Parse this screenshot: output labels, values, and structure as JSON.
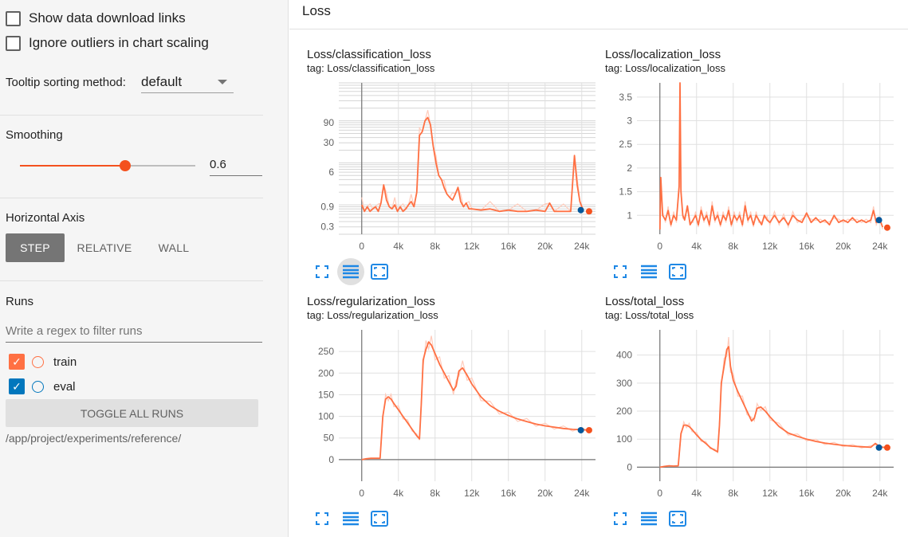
{
  "sidebar": {
    "show_download_links": "Show data download links",
    "ignore_outliers": "Ignore outliers in chart scaling",
    "tooltip_label": "Tooltip sorting method:",
    "tooltip_value": "default",
    "smoothing_label": "Smoothing",
    "smoothing_value": "0.6",
    "smoothing_fraction": 0.6,
    "horizontal_axis_label": "Horizontal Axis",
    "axis_buttons": {
      "step": "STEP",
      "relative": "RELATIVE",
      "wall": "WALL"
    },
    "runs_label": "Runs",
    "runs_filter_placeholder": "Write a regex to filter runs",
    "runs": [
      {
        "name": "train",
        "color": "#ff7043"
      },
      {
        "name": "eval",
        "color": "#0277bd"
      }
    ],
    "toggle_all": "TOGGLE ALL RUNS",
    "log_path": "/app/project/experiments/reference/"
  },
  "main": {
    "section_title": "Loss"
  },
  "colors": {
    "accent": "#f4511e",
    "train_line": "#ff7043",
    "train_raw": "#ffccbc",
    "eval_point": "#01579b",
    "toolbar_icon": "#1e88e5"
  },
  "icons": [
    "fullscreen-icon",
    "log-scale-icon",
    "fit-domain-icon"
  ],
  "chart_data": [
    {
      "type": "line",
      "title": "Loss/classification_loss",
      "tag": "tag: Loss/classification_loss",
      "yscale": "log",
      "yticks": [
        "90",
        "30",
        "6",
        "0.9",
        "0.3"
      ],
      "ytick_values": [
        90,
        30,
        6,
        0.9,
        0.3
      ],
      "xticks": [
        "0",
        "4k",
        "8k",
        "12k",
        "16k",
        "20k",
        "24k"
      ],
      "ylim": [
        0.2,
        800
      ],
      "xlim": [
        -2500,
        25500
      ],
      "series": [
        {
          "x": [
            0,
            300,
            600,
            900,
            1200,
            1500,
            1800,
            2100,
            2400,
            2700,
            3000,
            3300,
            3600,
            3900,
            4200,
            4500,
            4800,
            5100,
            5400,
            5700,
            6000,
            6300,
            6600,
            6900,
            7200,
            7500,
            7800,
            8100,
            8400,
            8700,
            9000,
            9300,
            9600,
            9900,
            10200,
            10500,
            10800,
            11100,
            11400,
            11700,
            12000,
            13000,
            14000,
            15000,
            16000,
            17000,
            18000,
            19000,
            20000,
            20500,
            21000,
            22000,
            22800,
            23200,
            23500,
            23800,
            24100
          ],
          "y": [
            1.0,
            0.7,
            0.9,
            0.7,
            0.8,
            0.9,
            0.7,
            1.1,
            3.0,
            1.3,
            0.9,
            0.8,
            1.0,
            0.7,
            0.9,
            0.7,
            0.8,
            1.0,
            1.2,
            0.9,
            2.0,
            45,
            55,
            100,
            120,
            80,
            25,
            10,
            5,
            4,
            2.5,
            1.8,
            1.5,
            1.3,
            1.8,
            2.6,
            1.2,
            0.9,
            1.1,
            0.8,
            0.8,
            0.75,
            0.8,
            0.7,
            0.75,
            0.7,
            0.7,
            0.75,
            0.7,
            1.1,
            0.7,
            0.7,
            0.7,
            15,
            3.0,
            1.2,
            0.8
          ]
        }
      ],
      "eval_points": [
        {
          "x": 23900,
          "y": 0.75
        }
      ],
      "last_point": {
        "x": 24800,
        "y": 0.7
      }
    },
    {
      "type": "line",
      "title": "Loss/localization_loss",
      "tag": "tag: Loss/localization_loss",
      "yscale": "linear",
      "yticks": [
        "1",
        "1.5",
        "2",
        "2.5",
        "3",
        "3.5"
      ],
      "ytick_values": [
        1,
        1.5,
        2,
        2.5,
        3,
        3.5
      ],
      "xticks": [
        "0",
        "4k",
        "8k",
        "12k",
        "16k",
        "20k",
        "24k"
      ],
      "ylim": [
        0.6,
        3.8
      ],
      "xlim": [
        -2500,
        25500
      ],
      "series": [
        {
          "x": [
            0,
            100,
            300,
            600,
            900,
            1200,
            1500,
            1800,
            2100,
            2200,
            2300,
            2500,
            2700,
            3000,
            3300,
            3600,
            3900,
            4200,
            4500,
            4800,
            5100,
            5400,
            5700,
            6000,
            6300,
            6600,
            6900,
            7200,
            7500,
            7800,
            8100,
            8400,
            8700,
            9000,
            9300,
            9600,
            9900,
            10200,
            10500,
            10800,
            11100,
            11400,
            11700,
            12000,
            12500,
            13000,
            13500,
            14000,
            14500,
            15000,
            15500,
            16000,
            16500,
            17000,
            17500,
            18000,
            18500,
            19000,
            19500,
            20000,
            20500,
            21000,
            21500,
            22000,
            22500,
            23000,
            23300,
            23600,
            24000,
            24300
          ],
          "y": [
            0.7,
            1.8,
            1.0,
            0.9,
            1.1,
            0.8,
            1.0,
            0.9,
            1.6,
            3.8,
            1.5,
            1.0,
            0.9,
            1.2,
            0.8,
            0.9,
            1.0,
            0.8,
            1.1,
            0.9,
            1.0,
            0.8,
            1.2,
            0.9,
            1.0,
            0.8,
            1.0,
            0.9,
            1.1,
            0.8,
            1.0,
            0.9,
            1.0,
            0.8,
            1.2,
            0.9,
            1.0,
            0.8,
            1.0,
            0.9,
            0.8,
            1.0,
            0.9,
            0.85,
            1.0,
            0.85,
            0.95,
            0.8,
            1.0,
            0.9,
            0.85,
            1.05,
            0.85,
            0.95,
            0.85,
            0.9,
            0.8,
            1.0,
            0.85,
            0.9,
            0.85,
            0.95,
            0.85,
            0.9,
            0.85,
            0.9,
            1.1,
            0.85,
            0.9,
            0.75
          ]
        }
      ],
      "eval_points": [
        {
          "x": 23900,
          "y": 0.9
        }
      ],
      "last_point": {
        "x": 24800,
        "y": 0.74
      }
    },
    {
      "type": "line",
      "title": "Loss/regularization_loss",
      "tag": "tag: Loss/regularization_loss",
      "yscale": "linear",
      "yticks": [
        "0",
        "50",
        "100",
        "150",
        "200",
        "250"
      ],
      "ytick_values": [
        0,
        50,
        100,
        150,
        200,
        250
      ],
      "xticks": [
        "0",
        "4k",
        "8k",
        "12k",
        "16k",
        "20k",
        "24k"
      ],
      "ylim": [
        -50,
        300
      ],
      "xlim": [
        -2500,
        25500
      ],
      "series": [
        {
          "x": [
            0,
            500,
            1000,
            1500,
            2000,
            2300,
            2600,
            2900,
            3200,
            3500,
            4000,
            4500,
            5000,
            5500,
            6000,
            6300,
            6500,
            6700,
            7000,
            7300,
            7600,
            8000,
            8500,
            9000,
            9500,
            10000,
            10300,
            10600,
            11000,
            11500,
            12000,
            13000,
            14000,
            15000,
            16000,
            17000,
            18000,
            19000,
            20000,
            21000,
            22000,
            23000,
            24000,
            24800
          ],
          "y": [
            0,
            2,
            3,
            3,
            3,
            100,
            140,
            145,
            140,
            130,
            115,
            100,
            85,
            70,
            55,
            48,
            130,
            230,
            255,
            272,
            265,
            245,
            220,
            200,
            180,
            160,
            170,
            205,
            212,
            195,
            175,
            145,
            125,
            112,
            102,
            94,
            88,
            82,
            78,
            75,
            72,
            70,
            69,
            68
          ]
        }
      ],
      "eval_points": [
        {
          "x": 23900,
          "y": 68
        }
      ],
      "last_point": {
        "x": 24800,
        "y": 68
      }
    },
    {
      "type": "line",
      "title": "Loss/total_loss",
      "tag": "tag: Loss/total_loss",
      "yscale": "linear",
      "yticks": [
        "0",
        "100",
        "200",
        "300",
        "400"
      ],
      "ytick_values": [
        0,
        100,
        200,
        300,
        400
      ],
      "xticks": [
        "0",
        "4k",
        "8k",
        "12k",
        "16k",
        "20k",
        "24k"
      ],
      "ylim": [
        -50,
        490
      ],
      "xlim": [
        -2500,
        25500
      ],
      "series": [
        {
          "x": [
            0,
            500,
            1000,
            1500,
            2000,
            2300,
            2600,
            2900,
            3200,
            3500,
            4000,
            4500,
            5000,
            5500,
            6000,
            6300,
            6500,
            6700,
            7000,
            7300,
            7500,
            7700,
            8000,
            8500,
            9000,
            9500,
            10000,
            10300,
            10600,
            11000,
            11500,
            12000,
            13000,
            14000,
            15000,
            16000,
            17000,
            18000,
            19000,
            20000,
            21000,
            22000,
            23000,
            23500,
            24000,
            24800
          ],
          "y": [
            0,
            3,
            5,
            4,
            5,
            120,
            150,
            150,
            145,
            135,
            115,
            98,
            85,
            70,
            60,
            55,
            150,
            300,
            360,
            420,
            430,
            360,
            310,
            270,
            235,
            200,
            165,
            175,
            210,
            215,
            200,
            180,
            145,
            122,
            110,
            100,
            92,
            86,
            82,
            78,
            75,
            73,
            71,
            85,
            72,
            70
          ]
        }
      ],
      "eval_points": [
        {
          "x": 23900,
          "y": 70
        }
      ],
      "last_point": {
        "x": 24800,
        "y": 70
      }
    }
  ]
}
